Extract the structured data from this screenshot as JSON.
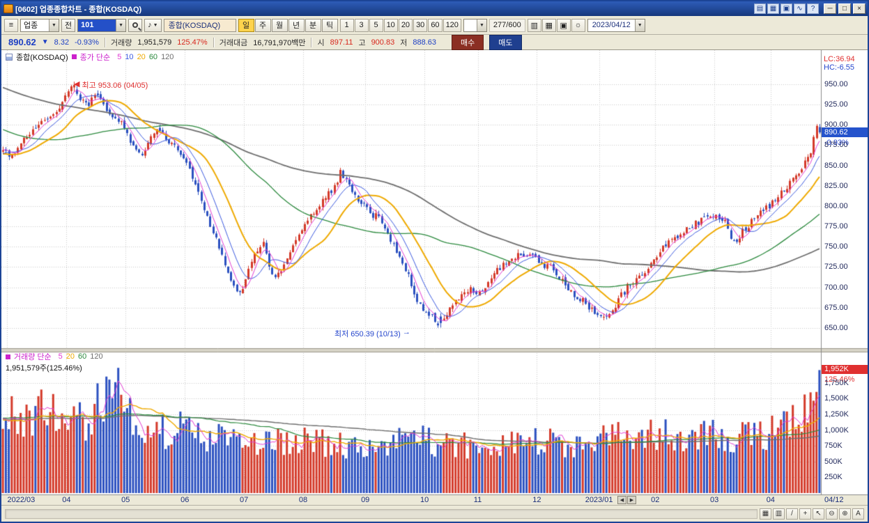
{
  "window": {
    "title": "[0602] 업종종합차트 - 종합(KOSDAQ)"
  },
  "toolbar": {
    "sector_dropdown": "업종",
    "all_button": "전",
    "code_input": "101",
    "name_field": "종합(KOSDAQ)",
    "period_buttons": [
      "일",
      "주",
      "월",
      "년",
      "분",
      "틱"
    ],
    "active_period": "일",
    "interval_buttons": [
      "1",
      "3",
      "5",
      "10",
      "20",
      "30",
      "60",
      "120"
    ],
    "candle_counter": "277/600",
    "date_field": "2023/04/12"
  },
  "quote": {
    "price": "890.62",
    "direction": "▼",
    "change": "8.32",
    "change_pct": "-0.93%",
    "volume_label": "거래량",
    "volume": "1,951,579",
    "volume_pct": "125.47%",
    "value_label": "거래대금",
    "value": "16,791,970백만",
    "open_label": "시",
    "open": "897.11",
    "high_label": "고",
    "high": "900.83",
    "low_label": "저",
    "low": "888.63",
    "buy_button": "매수",
    "sell_button": "매도"
  },
  "chart": {
    "legend_title": "종합(KOSDAQ)",
    "price_legend": {
      "label": "종가 단순",
      "periods": [
        "5",
        "10",
        "20",
        "60",
        "120"
      ]
    },
    "volume_legend": {
      "label": "거래량 단순",
      "periods": [
        "5",
        "20",
        "60",
        "120"
      ]
    },
    "volume_readout": "1,951,579주(125.46%)",
    "lc_label": "LC:36.94",
    "hc_label": "HC:-6.55",
    "high_annotation": "최고 953.06 (04/05)",
    "low_annotation": "최저 650.39 (10/13)",
    "price_tag": "890.62",
    "price_tag_pct": "-0.93%",
    "volume_tag": "1,952K",
    "volume_tag_pct": "125.46%",
    "axis_end_label": "04/12"
  },
  "chart_data": {
    "type": "candlestick",
    "candle_count": 277,
    "seed": 20230412,
    "price_range": [
      625,
      985
    ],
    "price_ticks": [
      650,
      675,
      700,
      725,
      750,
      775,
      800,
      825,
      850,
      875,
      900,
      925,
      950
    ],
    "volume_ticks_k": [
      250,
      500,
      750,
      1000,
      1250,
      1500,
      1750
    ],
    "volume_max_k": 2100,
    "up_color": "#d43a2a",
    "down_color": "#2b50c0",
    "ma_colors": {
      "5": "#e23bd4",
      "10": "#3c5ae0",
      "20": "#efaa02",
      "60": "#2c8a3e",
      "120": "#6e6e6e"
    },
    "high_point": {
      "idx": 24,
      "price": 953.06
    },
    "low_point": {
      "idx": 148,
      "price": 650.39
    },
    "last_candle": {
      "open": 897.11,
      "high": 900.83,
      "low": 888.63,
      "close": 890.62,
      "volume_k": 1952
    },
    "x_labels": [
      {
        "label": "2022/03",
        "idx": 2
      },
      {
        "label": "04",
        "idx": 22
      },
      {
        "label": "05",
        "idx": 42
      },
      {
        "label": "06",
        "idx": 62
      },
      {
        "label": "07",
        "idx": 82
      },
      {
        "label": "08",
        "idx": 102
      },
      {
        "label": "09",
        "idx": 123
      },
      {
        "label": "10",
        "idx": 143
      },
      {
        "label": "11",
        "idx": 161
      },
      {
        "label": "12",
        "idx": 181
      },
      {
        "label": "2023/01",
        "idx": 202
      },
      {
        "label": "02",
        "idx": 221
      },
      {
        "label": "03",
        "idx": 241
      },
      {
        "label": "04",
        "idx": 260
      }
    ],
    "price_anchors": [
      [
        -120,
        1035
      ],
      [
        -80,
        990
      ],
      [
        -50,
        930
      ],
      [
        -25,
        880
      ],
      [
        -10,
        858
      ],
      [
        0,
        872
      ],
      [
        3,
        860
      ],
      [
        6,
        878
      ],
      [
        10,
        892
      ],
      [
        14,
        903
      ],
      [
        18,
        918
      ],
      [
        21,
        935
      ],
      [
        24,
        948
      ],
      [
        26,
        930
      ],
      [
        29,
        925
      ],
      [
        32,
        940
      ],
      [
        35,
        920
      ],
      [
        38,
        908
      ],
      [
        40,
        900
      ],
      [
        43,
        882
      ],
      [
        46,
        862
      ],
      [
        49,
        876
      ],
      [
        52,
        894
      ],
      [
        55,
        886
      ],
      [
        58,
        872
      ],
      [
        61,
        860
      ],
      [
        64,
        836
      ],
      [
        67,
        806
      ],
      [
        70,
        778
      ],
      [
        73,
        748
      ],
      [
        76,
        716
      ],
      [
        79,
        694
      ],
      [
        81,
        702
      ],
      [
        84,
        730
      ],
      [
        86,
        746
      ],
      [
        88,
        752
      ],
      [
        90,
        726
      ],
      [
        92,
        710
      ],
      [
        94,
        722
      ],
      [
        97,
        746
      ],
      [
        100,
        766
      ],
      [
        103,
        784
      ],
      [
        106,
        798
      ],
      [
        109,
        810
      ],
      [
        112,
        825
      ],
      [
        114,
        840
      ],
      [
        116,
        833
      ],
      [
        118,
        820
      ],
      [
        121,
        804
      ],
      [
        124,
        792
      ],
      [
        127,
        786
      ],
      [
        130,
        766
      ],
      [
        133,
        746
      ],
      [
        135,
        730
      ],
      [
        137,
        716
      ],
      [
        139,
        692
      ],
      [
        141,
        676
      ],
      [
        143,
        668
      ],
      [
        145,
        662
      ],
      [
        147,
        656
      ],
      [
        148,
        654
      ],
      [
        150,
        666
      ],
      [
        152,
        680
      ],
      [
        155,
        694
      ],
      [
        158,
        700
      ],
      [
        161,
        692
      ],
      [
        164,
        708
      ],
      [
        167,
        720
      ],
      [
        170,
        730
      ],
      [
        173,
        736
      ],
      [
        176,
        742
      ],
      [
        179,
        740
      ],
      [
        182,
        730
      ],
      [
        185,
        724
      ],
      [
        188,
        712
      ],
      [
        191,
        698
      ],
      [
        194,
        688
      ],
      [
        197,
        680
      ],
      [
        200,
        670
      ],
      [
        203,
        662
      ],
      [
        205,
        666
      ],
      [
        208,
        684
      ],
      [
        211,
        700
      ],
      [
        214,
        708
      ],
      [
        217,
        718
      ],
      [
        220,
        734
      ],
      [
        223,
        748
      ],
      [
        226,
        758
      ],
      [
        229,
        766
      ],
      [
        232,
        774
      ],
      [
        235,
        780
      ],
      [
        238,
        786
      ],
      [
        241,
        788
      ],
      [
        244,
        780
      ],
      [
        247,
        755
      ],
      [
        250,
        768
      ],
      [
        253,
        782
      ],
      [
        256,
        792
      ],
      [
        259,
        800
      ],
      [
        262,
        812
      ],
      [
        265,
        824
      ],
      [
        268,
        838
      ],
      [
        270,
        848
      ],
      [
        272,
        862
      ],
      [
        273,
        868
      ],
      [
        274,
        884
      ],
      [
        275,
        899
      ],
      [
        276,
        891
      ]
    ],
    "volume_anchors_k": [
      [
        -120,
        1100
      ],
      [
        0,
        1250
      ],
      [
        6,
        1150
      ],
      [
        12,
        1300
      ],
      [
        18,
        1220
      ],
      [
        24,
        1300
      ],
      [
        28,
        1180
      ],
      [
        32,
        1350
      ],
      [
        35,
        1650
      ],
      [
        37,
        1900
      ],
      [
        39,
        1600
      ],
      [
        42,
        1350
      ],
      [
        46,
        1150
      ],
      [
        50,
        1020
      ],
      [
        55,
        960
      ],
      [
        60,
        1000
      ],
      [
        65,
        940
      ],
      [
        70,
        890
      ],
      [
        75,
        840
      ],
      [
        80,
        800
      ],
      [
        85,
        780
      ],
      [
        90,
        760
      ],
      [
        95,
        810
      ],
      [
        100,
        860
      ],
      [
        105,
        810
      ],
      [
        110,
        780
      ],
      [
        115,
        750
      ],
      [
        120,
        710
      ],
      [
        125,
        690
      ],
      [
        130,
        760
      ],
      [
        135,
        830
      ],
      [
        140,
        890
      ],
      [
        145,
        830
      ],
      [
        150,
        780
      ],
      [
        155,
        750
      ],
      [
        160,
        730
      ],
      [
        165,
        760
      ],
      [
        170,
        800
      ],
      [
        175,
        830
      ],
      [
        180,
        850
      ],
      [
        185,
        800
      ],
      [
        190,
        770
      ],
      [
        195,
        750
      ],
      [
        200,
        800
      ],
      [
        205,
        850
      ],
      [
        210,
        900
      ],
      [
        215,
        870
      ],
      [
        220,
        920
      ],
      [
        225,
        950
      ],
      [
        230,
        900
      ],
      [
        235,
        870
      ],
      [
        240,
        930
      ],
      [
        245,
        890
      ],
      [
        250,
        870
      ],
      [
        255,
        930
      ],
      [
        260,
        990
      ],
      [
        264,
        1060
      ],
      [
        268,
        1130
      ],
      [
        271,
        1260
      ],
      [
        274,
        1420
      ],
      [
        276,
        1700
      ]
    ]
  },
  "icons": {
    "menu": "≡",
    "dropdown_arrow": "▼",
    "speaker": "♪",
    "minimize": "─",
    "maximize": "□",
    "close": "×",
    "left_arrow": "◀",
    "right_arrow": "→",
    "scroll_left": "◀",
    "scroll_right": "▶",
    "title_icons": [
      {
        "name": "keyboard-icon",
        "glyph": "▤"
      },
      {
        "name": "multi-screen-icon",
        "glyph": "▦"
      },
      {
        "name": "copy-window-icon",
        "glyph": "▣"
      },
      {
        "name": "mini-chart-icon",
        "glyph": "∿"
      },
      {
        "name": "help-icon",
        "glyph": "?"
      }
    ],
    "tool_icons": [
      {
        "name": "chart-style-icon",
        "glyph": "▥"
      },
      {
        "name": "compare-chart-icon",
        "glyph": "▦"
      },
      {
        "name": "save-chart-icon",
        "glyph": "▣"
      },
      {
        "name": "settings-gear-icon",
        "glyph": "☼"
      }
    ],
    "bottom_icons": [
      {
        "name": "grid-toggle-icon",
        "glyph": "▦"
      },
      {
        "name": "pane-layout-icon",
        "glyph": "▥"
      },
      {
        "name": "trend-line-icon",
        "glyph": "/"
      },
      {
        "name": "crosshair-icon",
        "glyph": "+"
      },
      {
        "name": "pointer-icon",
        "glyph": "↖"
      },
      {
        "name": "zoom-out-icon",
        "glyph": "⊖"
      },
      {
        "name": "zoom-in-icon",
        "glyph": "⊕"
      },
      {
        "name": "font-size-icon",
        "glyph": "A"
      }
    ]
  }
}
